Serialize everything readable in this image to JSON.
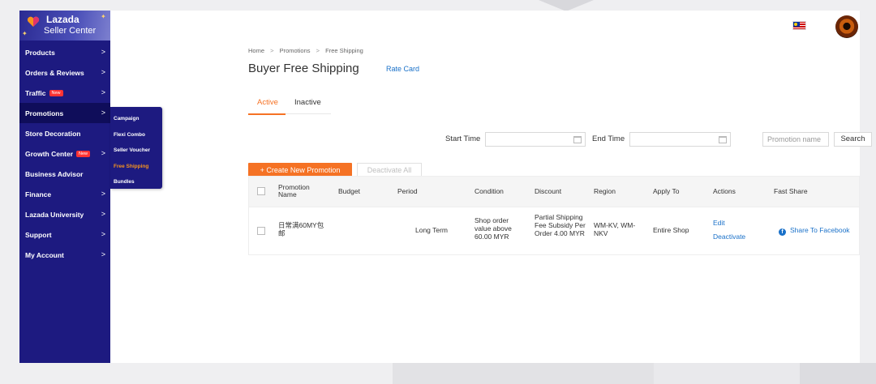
{
  "brand": {
    "title": "Lazada",
    "subtitle": "Seller Center",
    "color": "#1d1a80"
  },
  "sidebar": {
    "items": [
      {
        "label": "Products",
        "chevron": ">"
      },
      {
        "label": "Orders & Reviews",
        "chevron": ">"
      },
      {
        "label": "Traffic",
        "badge": "New",
        "chevron": ">"
      },
      {
        "label": "Promotions",
        "chevron": ">"
      },
      {
        "label": "Store Decoration"
      },
      {
        "label": "Growth Center",
        "badge": "New",
        "chevron": ">"
      },
      {
        "label": "Business Advisor"
      },
      {
        "label": "Finance",
        "chevron": ">"
      },
      {
        "label": "Lazada University",
        "chevron": ">"
      },
      {
        "label": "Support",
        "chevron": ">"
      },
      {
        "label": "My Account",
        "chevron": ">"
      }
    ],
    "flyout": [
      "Campaign",
      "Flexi Combo",
      "Seller Voucher",
      "Free Shipping",
      "Bundles"
    ]
  },
  "breadcrumb": [
    "Home",
    "Promotions",
    "Free Shipping"
  ],
  "breadcrumb_sep": ">",
  "page": {
    "title": "Buyer Free Shipping",
    "rate_card": "Rate Card"
  },
  "tabs": {
    "active": "Active",
    "inactive": "Inactive"
  },
  "filters": {
    "start_time_label": "Start Time",
    "end_time_label": "End Time",
    "promotion_name_placeholder": "Promotion name",
    "search_label": "Search"
  },
  "actions": {
    "create_label": "+ Create New Promotion",
    "deactivate_all_label": "Deactivate All"
  },
  "table": {
    "headers": {
      "name": "Promotion Name",
      "budget": "Budget",
      "period": "Period",
      "condition": "Condition",
      "discount": "Discount",
      "region": "Region",
      "apply_to": "Apply To",
      "actions": "Actions",
      "fast_share": "Fast Share"
    },
    "rows": [
      {
        "name": "日常满60MY包邮",
        "budget": "",
        "period": "Long Term",
        "condition": "Shop order value above 60.00 MYR",
        "discount": "Partial Shipping Fee Subsidy Per Order 4.00 MYR",
        "region": "WM-KV, WM-NKV",
        "apply_to": "Entire Shop",
        "edit_label": "Edit",
        "deactivate_label": "Deactivate",
        "share_label": "Share To Facebook"
      }
    ]
  },
  "colors": {
    "accent": "#f57224",
    "link": "#1a71c9",
    "badge": "#ff3333"
  }
}
